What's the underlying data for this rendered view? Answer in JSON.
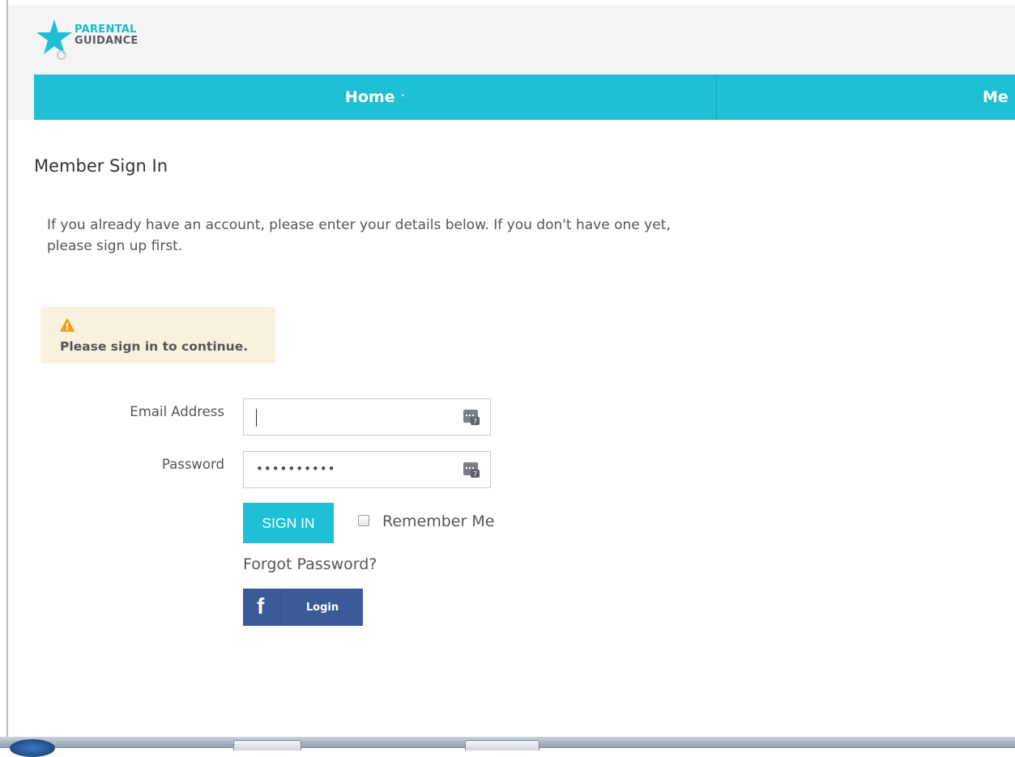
{
  "logo": {
    "line1": "PARENTAL",
    "line2": "GUIDANCE"
  },
  "nav": {
    "home_label": "Home",
    "home_chevron": "˅",
    "next_label": "Me"
  },
  "page": {
    "title": "Member Sign In",
    "intro": "If you already have an account, please enter your details below. If you don't have one yet, please sign up first."
  },
  "alert": {
    "icon": "warning-triangle-icon",
    "message": "Please sign in to continue."
  },
  "form": {
    "email_label": "Email Address",
    "email_value": "",
    "password_label": "Password",
    "password_value": "••••••••••",
    "signin_button": "SIGN IN",
    "remember_label": "Remember Me",
    "remember_checked": false,
    "forgot_link": "Forgot Password?",
    "facebook_icon": "f",
    "facebook_button": "Login"
  },
  "colors": {
    "accent": "#1fbfd6",
    "facebook": "#3b5a9a",
    "alert_bg": "#f7f1de",
    "warning": "#f0a020"
  }
}
